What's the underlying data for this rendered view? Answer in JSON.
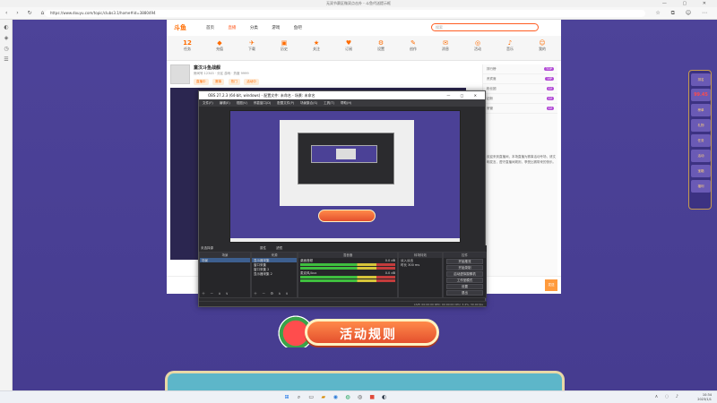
{
  "browser": {
    "window_title": "无双节赛区微双点击外 - 斗鱼代送提示框",
    "url": "https://www.douyu.com/topic/clubs3.1/home#id=3880494",
    "sidebar_icons": [
      "chat-icon",
      "shield-icon",
      "history-icon",
      "menu-icon"
    ]
  },
  "site": {
    "logo": "斗鱼",
    "nav": [
      {
        "label": "首页"
      },
      {
        "label": "直播",
        "active": true
      },
      {
        "label": "分类"
      },
      {
        "label": "游戏"
      },
      {
        "label": "鱼吧"
      }
    ],
    "search_placeholder": "搜索",
    "icon_bar": [
      {
        "icon": "12",
        "label": "任务"
      },
      {
        "icon": "◆",
        "label": "充值"
      },
      {
        "icon": "✈",
        "label": "下载"
      },
      {
        "icon": "▣",
        "label": "历史"
      },
      {
        "icon": "★",
        "label": "关注"
      },
      {
        "icon": "♥",
        "label": "订阅"
      },
      {
        "icon": "⚙",
        "label": "设置"
      },
      {
        "icon": "✎",
        "label": "创作"
      },
      {
        "icon": "✉",
        "label": "消息"
      },
      {
        "icon": "◎",
        "label": "活动"
      },
      {
        "icon": "♪",
        "label": "音乐"
      },
      {
        "icon": "☺",
        "label": "我的"
      }
    ]
  },
  "room": {
    "streamer_name": "童汉斗鱼战舰",
    "meta": "房间号 12345 · 分区 游戏 · 热度 9999",
    "tags": [
      "直播中",
      "赛事",
      "热门",
      "活动中"
    ],
    "chat_rows": [
      {
        "text": "排行榜",
        "badge": "TOP"
      },
      {
        "text": "贵宾席",
        "badge": "VIP"
      },
      {
        "text": "粉丝团",
        "badge": "LV"
      },
      {
        "text": "钻粉",
        "badge": "LV"
      },
      {
        "text": "房管",
        "badge": "LV"
      }
    ],
    "description": "欢迎来到直播间，本场直播为赛事活动专场，请文明发言，遵守直播间规则，享受比赛带来的快乐。",
    "send_label": "发送"
  },
  "right_panel": {
    "rank_label": "排名",
    "rank_value": "99.45",
    "items": [
      "榜单",
      "礼物",
      "任务",
      "活动",
      "宝箱",
      "福利"
    ]
  },
  "event_banner": {
    "text": "活动规则"
  },
  "obs": {
    "title": "OBS 27.2.3 (64-bit, windows) - 配置文件: 未命名 - 场景: 未命名",
    "menu": [
      "文件(F)",
      "编辑(E)",
      "视图(V)",
      "停靠窗口(D)",
      "配置文件(P)",
      "场景集合(S)",
      "工具(T)",
      "帮助(H)"
    ],
    "tabs": [
      "未选择源",
      "属性",
      "滤镜"
    ],
    "scenes_header": "场景",
    "scenes": [
      "场景"
    ],
    "sources_header": "来源",
    "sources": [
      "显示器采集",
      "窗口采集",
      "窗口采集 2",
      "显示器采集 2"
    ],
    "mixer_header": "混音器",
    "mixer": [
      {
        "name": "桌面音频",
        "level": "0.0 dB"
      },
      {
        "name": "麦克风/Aux",
        "level": "0.0 dB"
      }
    ],
    "transitions_header": "转场特效",
    "transition_value": "淡入淡出",
    "duration_label": "时长",
    "duration_value": "300 ms",
    "controls_header": "控件",
    "controls": [
      "开始推流",
      "开始录制",
      "启动虚拟摄像机",
      "工作室模式",
      "设置",
      "退出"
    ],
    "status": "LIVE: 00:00:00   REC: 00:00:00   CPU: 3.4%, 30.00 fps"
  },
  "taskbar": {
    "time": "10:34",
    "date": "2023/1/1"
  }
}
